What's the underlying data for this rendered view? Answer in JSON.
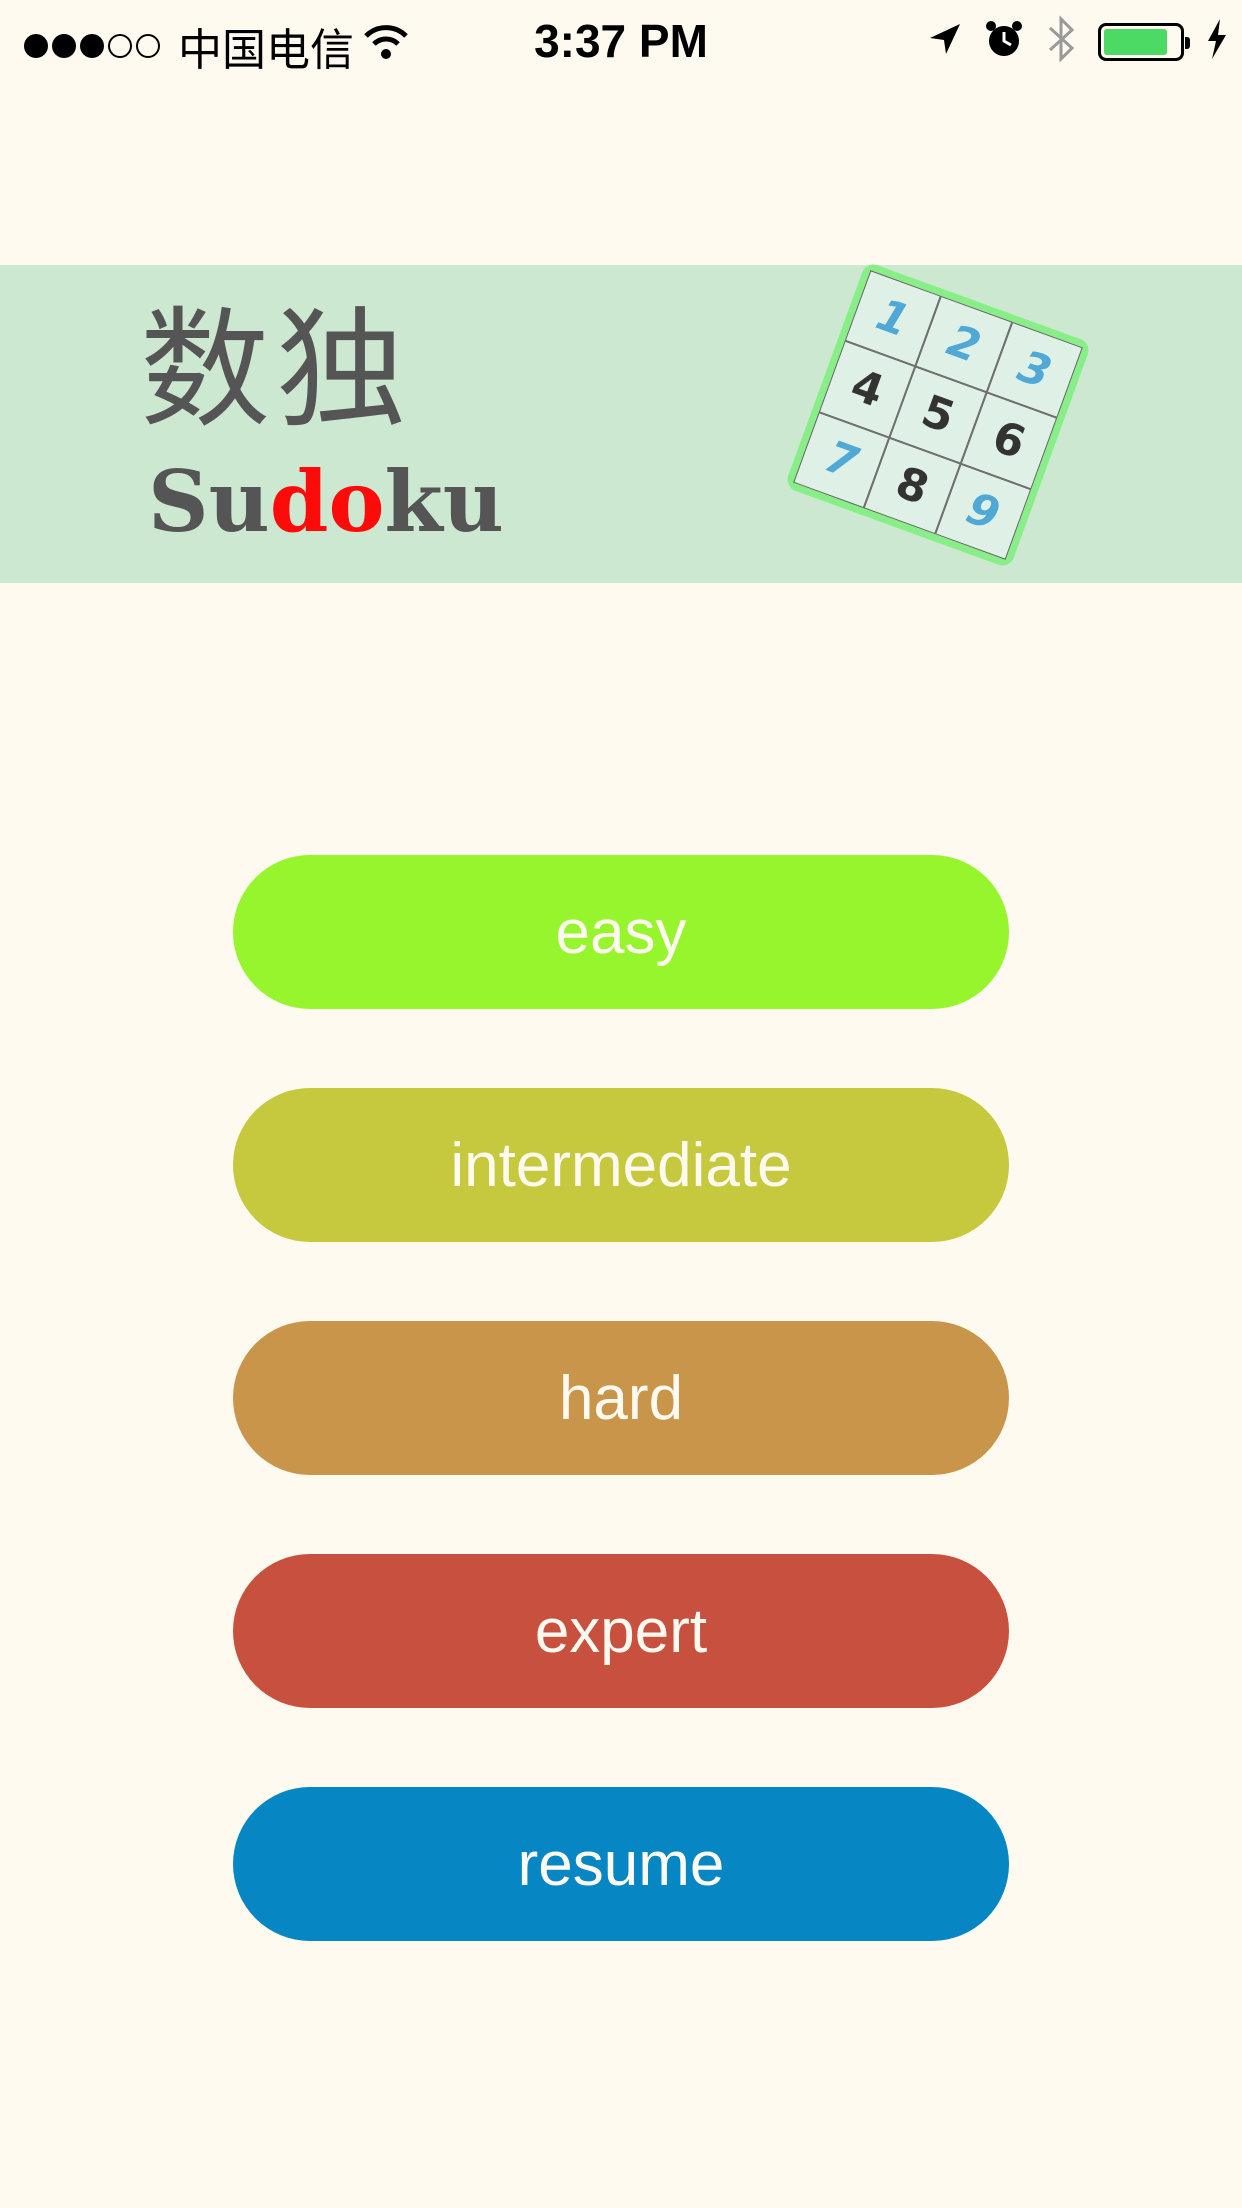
{
  "status_bar": {
    "carrier": "中国电信",
    "time": "3:37 PM",
    "signal_full": 3,
    "signal_total": 5,
    "battery_level": 0.85
  },
  "header": {
    "title_cn": "数独",
    "title_en_parts": [
      "Su",
      "do",
      "ku"
    ],
    "puzzle_cells": [
      "1",
      "2",
      "3",
      "4",
      "5",
      "6",
      "7",
      "8",
      "9"
    ]
  },
  "buttons": [
    {
      "label": "easy",
      "color": "#97f52e"
    },
    {
      "label": "intermediate",
      "color": "#c6c93d"
    },
    {
      "label": "hard",
      "color": "#c8954a"
    },
    {
      "label": "expert",
      "color": "#c8503e"
    },
    {
      "label": "resume",
      "color": "#0686c3"
    }
  ],
  "colors": {
    "background": "#fffaf0",
    "banner": "#cce8d0",
    "accent_red": "#ff0a0a",
    "puzzle_border": "#88ee88"
  }
}
